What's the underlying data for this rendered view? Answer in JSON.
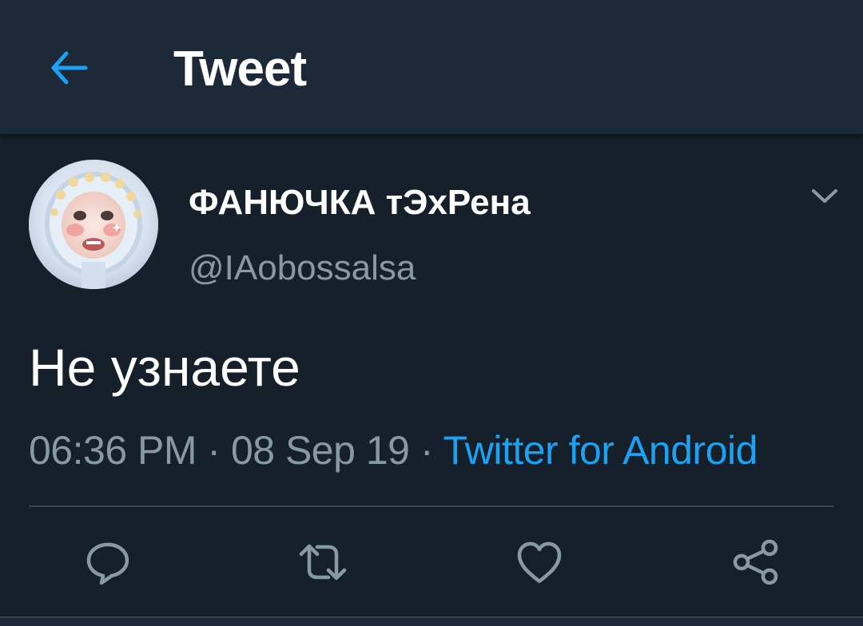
{
  "header": {
    "title": "Tweet",
    "back_icon": "arrow-left-icon"
  },
  "tweet": {
    "display_name": "ФАНЮЧКА тЭхРена",
    "handle": "@IAobossalsa",
    "text": "Не узнаете",
    "time": "06:36 PM",
    "date": "08 Sep 19",
    "separator": " · ",
    "source": "Twitter for Android",
    "avatar_icon": "profile-photo",
    "menu_icon": "chevron-down-icon"
  },
  "actions": [
    {
      "name": "reply",
      "icon": "comment-bubble-icon"
    },
    {
      "name": "retweet",
      "icon": "retweet-arrows-icon"
    },
    {
      "name": "like",
      "icon": "heart-icon"
    },
    {
      "name": "share",
      "icon": "share-nodes-icon"
    }
  ],
  "colors": {
    "background": "#15202b",
    "header": "#1c2938",
    "accent": "#1da1f2",
    "secondary_text": "#8899a6",
    "divider": "#38444d"
  }
}
